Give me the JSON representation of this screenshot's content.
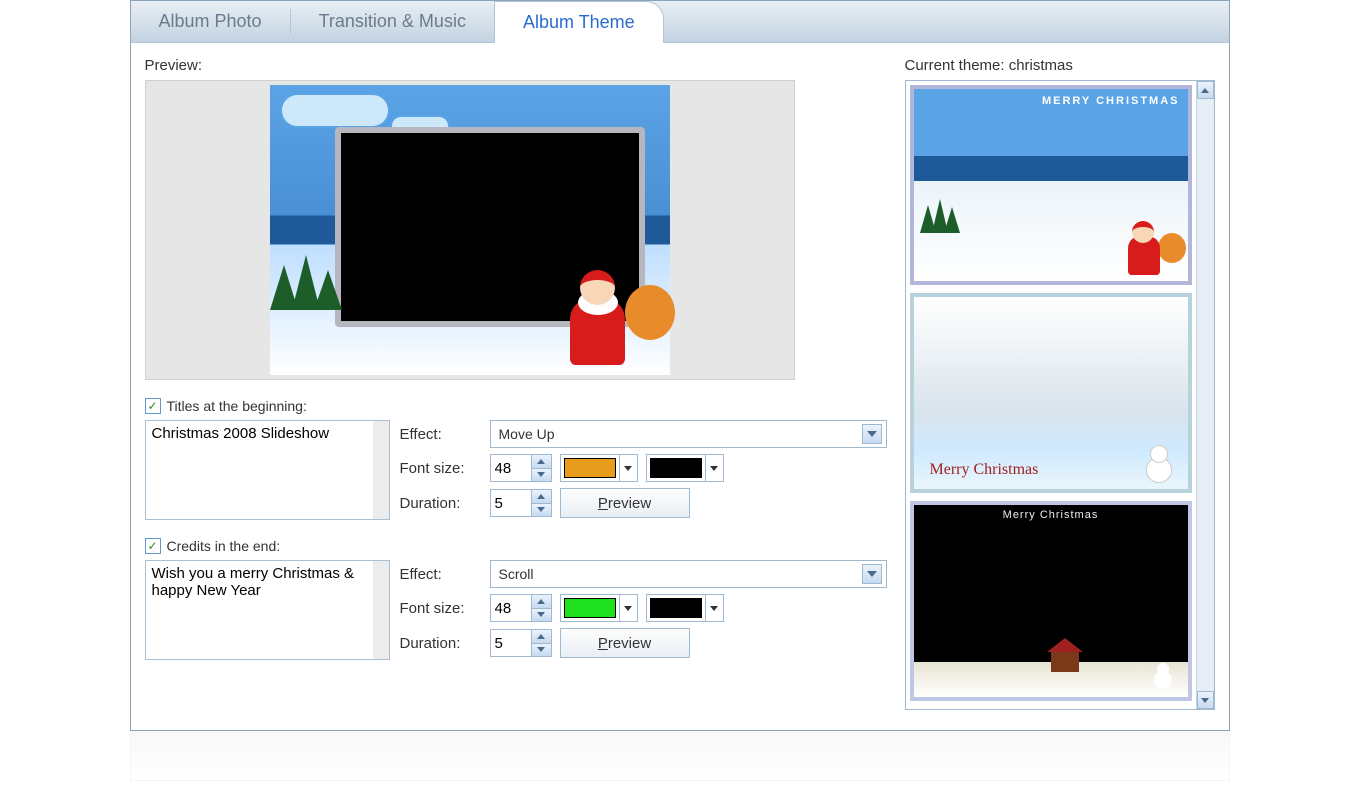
{
  "tabs": {
    "album_photo": "Album Photo",
    "transition_music": "Transition & Music",
    "album_theme": "Album Theme"
  },
  "left": {
    "preview_label": "Preview:",
    "titles": {
      "checkbox_label": "Titles at the beginning:",
      "checked": true,
      "text": "Christmas 2008 Slideshow",
      "effect_label": "Effect:",
      "effect_value": "Move Up",
      "font_size_label": "Font size:",
      "font_size_value": "48",
      "text_color": "#e89c1e",
      "bg_color": "#000000",
      "duration_label": "Duration:",
      "duration_value": "5",
      "preview_btn": "Preview",
      "preview_btn_accel": "P"
    },
    "credits": {
      "checkbox_label": "Credits in the end:",
      "checked": true,
      "text": "Wish you a merry Christmas & happy New Year",
      "effect_label": "Effect:",
      "effect_value": "Scroll",
      "font_size_label": "Font size:",
      "font_size_value": "48",
      "text_color": "#1ee01e",
      "bg_color": "#000000",
      "duration_label": "Duration:",
      "duration_value": "5",
      "preview_btn": "Preview",
      "preview_btn_accel": "P"
    }
  },
  "right": {
    "current_theme_label": "Current theme: christmas",
    "themes": [
      {
        "caption": "MERRY CHRISTMAS"
      },
      {
        "caption": "Merry Christmas"
      },
      {
        "caption": "Merry Christmas"
      }
    ]
  }
}
